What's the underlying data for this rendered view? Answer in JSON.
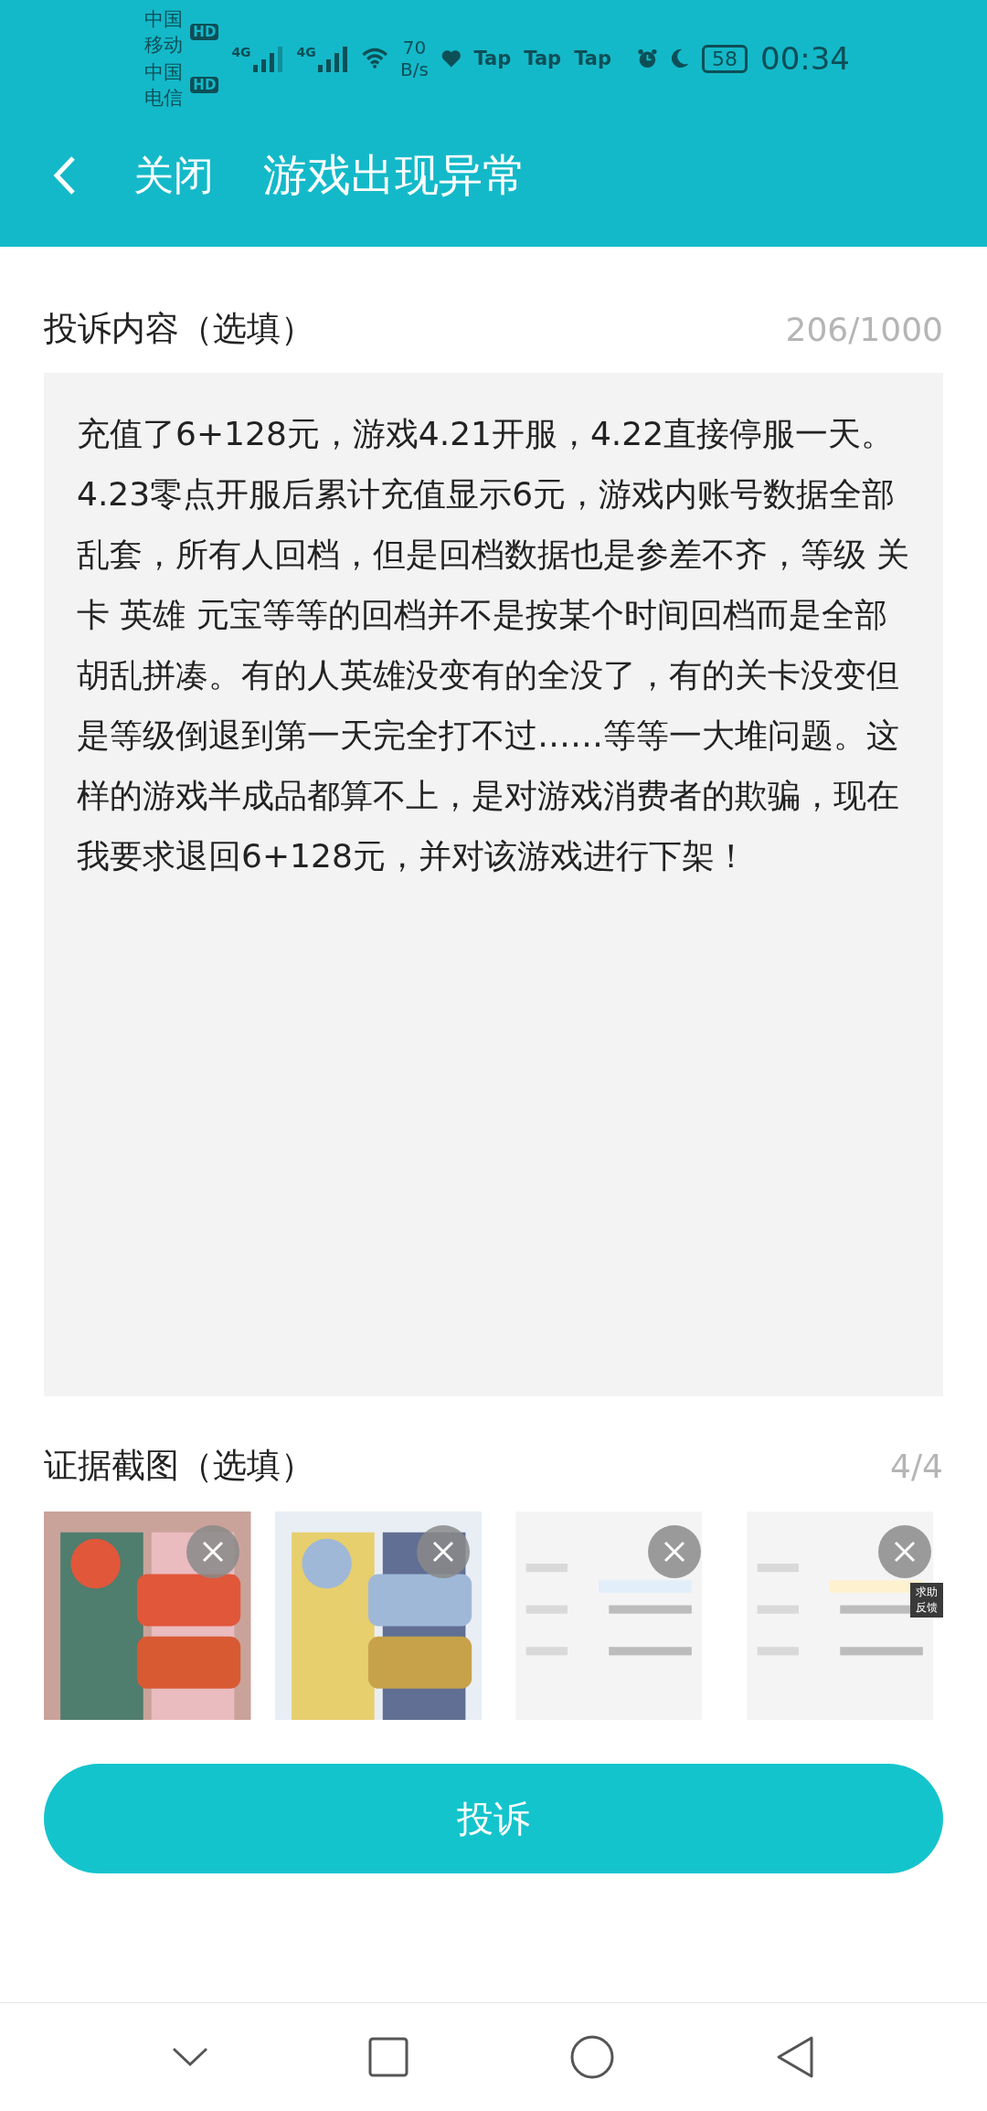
{
  "status_bar": {
    "carriers": [
      {
        "name": "中国移动",
        "badge": "HD"
      },
      {
        "name": "中国电信",
        "badge": "HD"
      }
    ],
    "network_types": [
      "4G",
      "4G"
    ],
    "speed_value": "70",
    "speed_unit": "B/s",
    "app_notifications": [
      "Tap",
      "Tap",
      "Tap"
    ],
    "battery": "58",
    "time": "00:34"
  },
  "header": {
    "close": "关闭",
    "title": "游戏出现异常"
  },
  "complaint": {
    "label": "投诉内容（选填）",
    "counter": "206/1000",
    "value": "充值了6+128元，游戏4.21开服，4.22直接停服一天。4.23零点开服后累计充值显示6元，游戏内账号数据全部乱套，所有人回档，但是回档数据也是参差不齐，等级 关卡 英雄 元宝等等的回档并不是按某个时间回档而是全部胡乱拼凑。有的人英雄没变有的全没了，有的关卡没变但是等级倒退到第一天完全打不过……等等一大堆问题。这样的游戏半成品都算不上，是对游戏消费者的欺骗，现在我要求退回6+128元，并对该游戏进行下架！"
  },
  "evidence": {
    "label": "证据截图（选填）",
    "counter": "4/4",
    "images": [
      {
        "kind": "picture"
      },
      {
        "kind": "picture"
      },
      {
        "kind": "picture"
      },
      {
        "kind": "picture"
      }
    ],
    "floating_help": [
      "求助",
      "反馈"
    ]
  },
  "submit": "投诉"
}
